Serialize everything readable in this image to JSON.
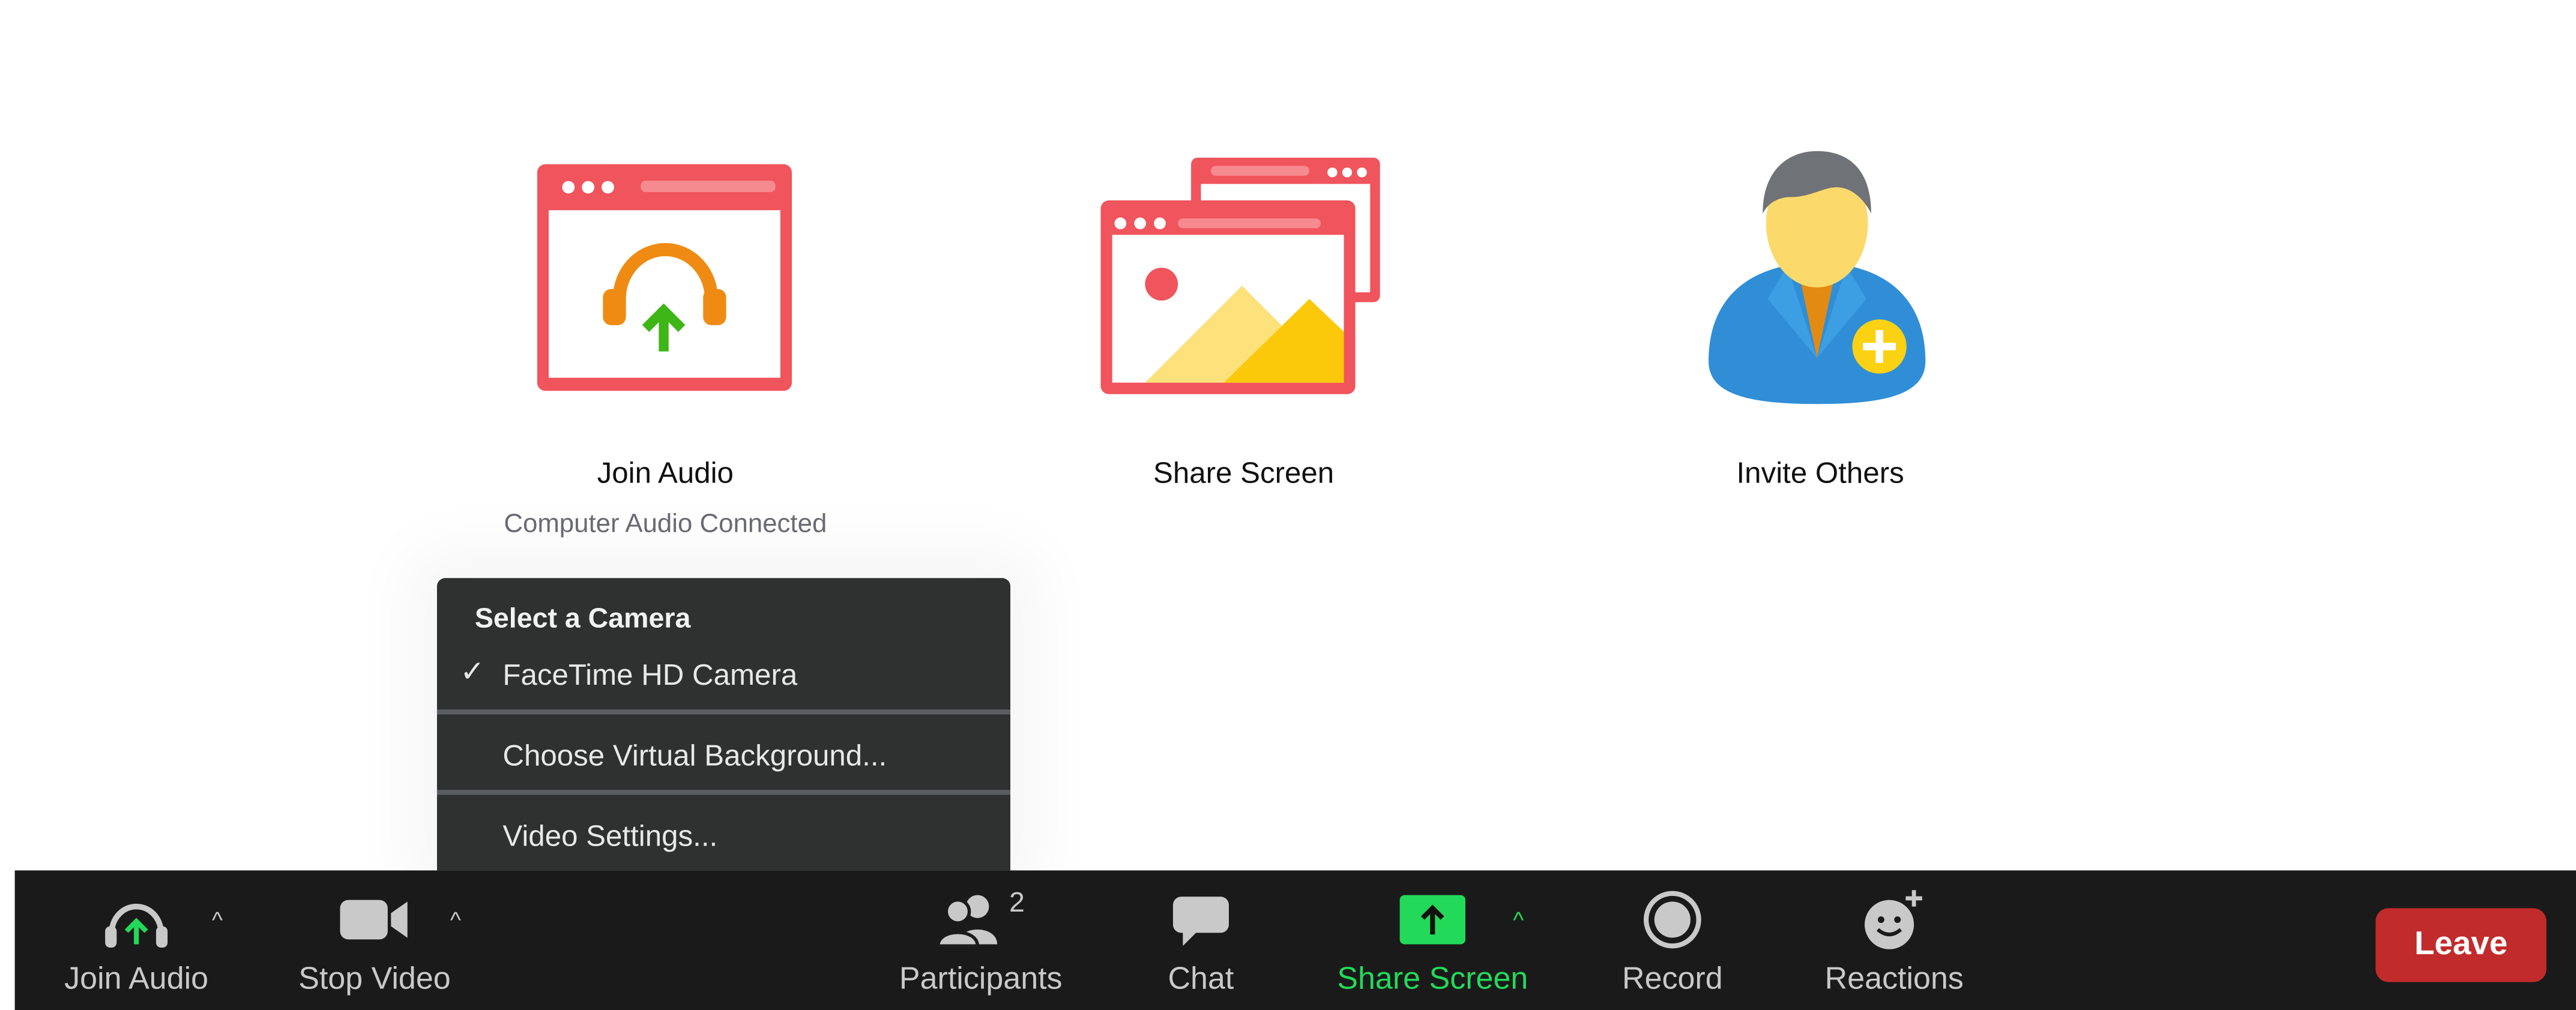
{
  "features": {
    "join_audio": {
      "title": "Join Audio",
      "subtitle": "Computer Audio Connected"
    },
    "share_screen": {
      "title": "Share Screen"
    },
    "invite_others": {
      "title": "Invite Others"
    }
  },
  "camera_menu": {
    "header": "Select a Camera",
    "items": [
      {
        "label": "FaceTime HD Camera",
        "checked": true
      },
      {
        "label": "Choose Virtual Background..."
      },
      {
        "label": "Video Settings..."
      }
    ]
  },
  "toolbar": {
    "join_audio": "Join Audio",
    "stop_video": "Stop Video",
    "participants": "Participants",
    "participants_count": "2",
    "chat": "Chat",
    "share_screen": "Share Screen",
    "record": "Record",
    "reactions": "Reactions",
    "leave": "Leave"
  },
  "icons": {
    "join_audio_feature": "headphones-upload-window-icon",
    "share_screen_feature": "windows-image-icon",
    "invite_others_feature": "person-add-icon",
    "menu_check": "checkmark-icon",
    "tb_join_audio": "headphones-icon",
    "tb_stop_video": "video-camera-icon",
    "tb_participants": "people-icon",
    "tb_chat": "chat-bubble-icon",
    "tb_share_screen": "share-arrow-icon",
    "tb_record": "record-icon",
    "tb_reactions": "smiley-plus-icon",
    "caret": "chevron-up-icon"
  },
  "colors": {
    "accent_red": "#f0545c",
    "share_green": "#23d959",
    "leave_red": "#c22b2b",
    "toolbar_bg": "#1a1a1a",
    "menu_bg": "#2f3131"
  }
}
